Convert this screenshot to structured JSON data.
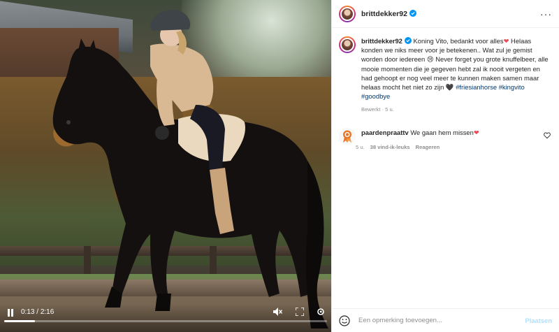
{
  "video": {
    "current_time": "0:13",
    "separator": "/",
    "duration": "2:16",
    "progress_fraction": 0.095
  },
  "post": {
    "username": "brittdekker92",
    "verified": true
  },
  "caption": {
    "username": "brittdekker92",
    "part1": " Koning Vito, bedankt voor alles",
    "part2": " Helaas konden we niks meer voor je betekenen.. Wat zul je gemist worden door iedereen ",
    "part3": " Never forget you grote knuffelbeer, alle mooie momenten die je gegeven hebt zal ik nooit vergeten en had gehoopt er nog veel meer te kunnen maken samen maar helaas mocht het niet zo zijn ",
    "hashtags": [
      "#friesianhorse",
      "#kingvito",
      "#goodbye"
    ],
    "meta": "Bewerkt · 5 u."
  },
  "comment": {
    "username": "paardenpraattv",
    "text": " We gaan hem missen",
    "time": "5 u.",
    "likes": "38 vind-ik-leuks",
    "reply": "Reageren"
  },
  "footer": {
    "placeholder": "Een opmerking toevoegen...",
    "post_label": "Plaatsen"
  },
  "colors": {
    "accent": "#0095f6",
    "post_disabled": "#b2dffc",
    "heart": "#ed4956",
    "hashtag": "#00376b",
    "muted": "#8e8e8e"
  }
}
